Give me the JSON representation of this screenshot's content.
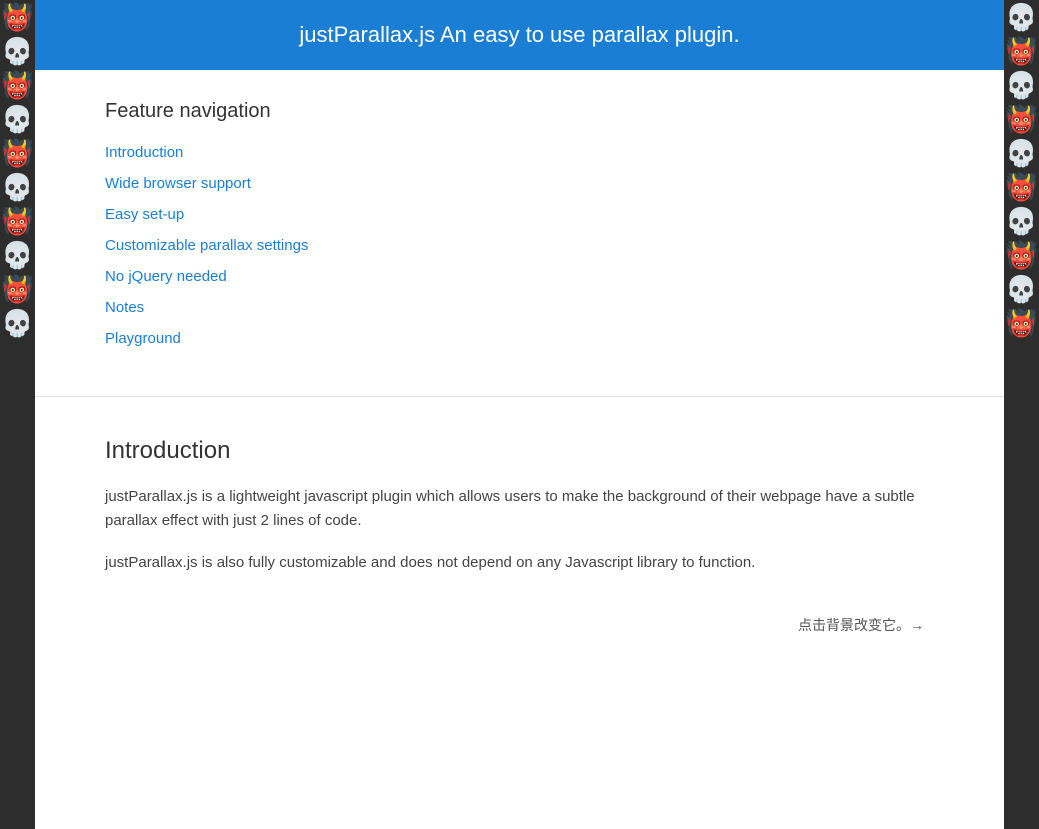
{
  "header": {
    "title": "justParallax.js   An easy to use parallax plugin."
  },
  "nav": {
    "heading": "Feature navigation",
    "links": [
      {
        "id": "introduction",
        "label": "Introduction"
      },
      {
        "id": "wide-browser-support",
        "label": "Wide browser support"
      },
      {
        "id": "easy-setup",
        "label": "Easy set-up"
      },
      {
        "id": "customizable-settings",
        "label": "Customizable parallax settings"
      },
      {
        "id": "no-jquery",
        "label": "No jQuery needed"
      },
      {
        "id": "notes",
        "label": "Notes"
      },
      {
        "id": "playground",
        "label": "Playground"
      }
    ]
  },
  "intro": {
    "heading": "Introduction",
    "paragraph1": "justParallax.js is a lightweight javascript plugin which allows users to make the background of their webpage have a subtle parallax effect with just 2 lines of code.",
    "paragraph2": "justParallax.js is also fully customizable and does not depend on any Javascript library to function.",
    "bottom_link_text": "点击背景改变它。→"
  }
}
